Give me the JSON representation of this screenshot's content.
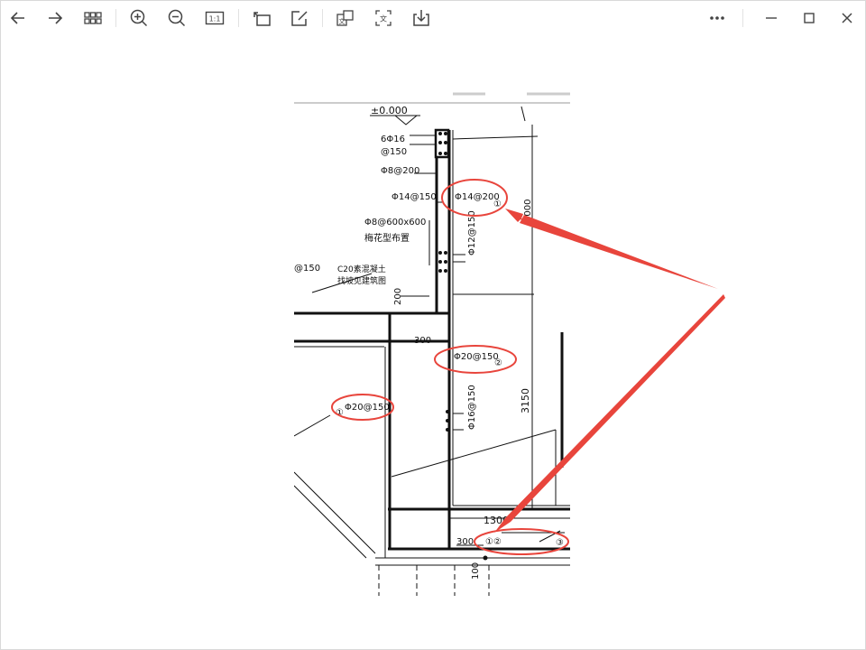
{
  "toolbar": {
    "icons": [
      "back-arrow-icon",
      "forward-arrow-icon",
      "grid-view-icon",
      "zoom-in-icon",
      "zoom-out-icon",
      "actual-size-icon",
      "rotate-icon",
      "edit-icon",
      "translate-image-icon",
      "ocr-text-icon",
      "save-download-icon",
      "more-icon",
      "minimize-icon",
      "maximize-icon",
      "close-icon"
    ],
    "actual_size_label": "1:1",
    "translate_label": "文",
    "ocr_label": "文"
  },
  "drawing": {
    "level_mark": "±0.000",
    "top_rebar": "6Φ16",
    "top_spacing": "@150",
    "stirrup": "Φ8@200",
    "horizontal_rebar": "Φ14@150",
    "circled_rebar_1": "Φ14@200",
    "circled_num_1": "①",
    "tie_bar": "Φ8@600x600",
    "tie_note": "梅花型布置",
    "wall_vertical": "Φ12@150",
    "left_partial": "@150",
    "concrete_note": "C20素混凝土",
    "slope_note": "找坡见建筑图",
    "dim_200": "200",
    "dim_300_mid": "300",
    "circled_rebar_2": "Φ20@150",
    "circled_num_2": "②",
    "circled_rebar_left": "Φ20@150",
    "circled_num_left": "①",
    "wall_lower": "Φ16@150",
    "dim_3150": "3150",
    "dim_top_vertical": "2000",
    "dim_1300": "1300",
    "dim_300_bottom": "300",
    "bottom_marks": "①②",
    "bottom_mark_3": "③",
    "dim_100": "100"
  },
  "colors": {
    "annotation_red": "#e8453c",
    "toolbar_icon": "#444444",
    "line": "#111111"
  }
}
